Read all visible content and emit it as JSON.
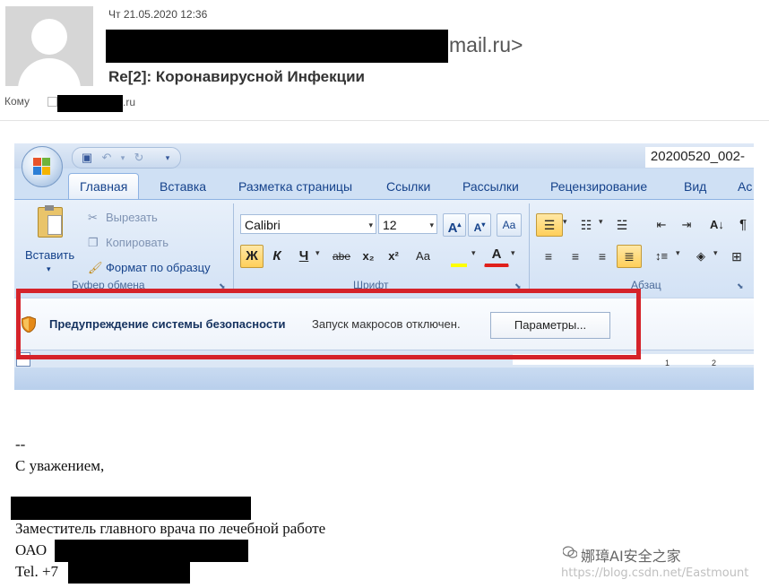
{
  "email": {
    "date": "Чт 21.05.2020 12:36",
    "sender_domain": "mail.ru>",
    "subject": "Re[2]: Коронавирусной Инфекции",
    "to_label": "Кому",
    "to_domain": ".ru"
  },
  "word": {
    "doc_title": "20200520_002-",
    "tabs": [
      "Главная",
      "Вставка",
      "Разметка страницы",
      "Ссылки",
      "Рассылки",
      "Рецензирование",
      "Вид",
      "Ас"
    ],
    "clipboard": {
      "paste_label": "Вставить",
      "cut_label": "Вырезать",
      "copy_label": "Копировать",
      "format_label": "Формат по образцу",
      "group_label": "Буфер обмена"
    },
    "font": {
      "font_name": "Calibri",
      "font_size": "12",
      "bold": "Ж",
      "italic": "К",
      "underline": "Ч",
      "strike": "abe",
      "subscript": "x₂",
      "superscript": "x²",
      "case": "Aa",
      "group_label": "Шрифт"
    },
    "paragraph": {
      "group_label": "Абзац"
    },
    "security": {
      "title": "Предупреждение системы безопасности",
      "message": "Запуск макросов отключен.",
      "button": "Параметры..."
    },
    "ruler_ticks": [
      "1",
      "2"
    ]
  },
  "signature": {
    "dashes": "--",
    "greeting": "С уважением,",
    "position": "Заместитель главного врача по лечебной работе",
    "org_prefix": "ОАО",
    "tel_prefix": "Tel. +7"
  },
  "watermark": {
    "text": "娜璋AI安全之家",
    "url": "https://blog.csdn.net/Eastmount"
  },
  "colors": {
    "highlight_box": "#d5232a",
    "ribbon_blue": "#d3e2f5",
    "accent_text": "#15428b"
  }
}
